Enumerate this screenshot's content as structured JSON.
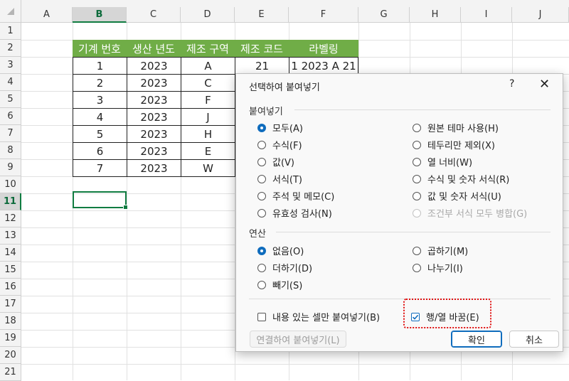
{
  "columns": [
    "A",
    "B",
    "C",
    "D",
    "E",
    "F",
    "G",
    "H",
    "I",
    "J"
  ],
  "rows": [
    "1",
    "2",
    "3",
    "4",
    "5",
    "6",
    "7",
    "8",
    "9",
    "10",
    "11",
    "12",
    "13",
    "14",
    "15",
    "16",
    "17",
    "18",
    "19",
    "20",
    "21"
  ],
  "table": {
    "headers": [
      "기계 번호",
      "생산 년도",
      "제조 구역",
      "제조 코드",
      "라벨링"
    ],
    "rows": [
      [
        "1",
        "2023",
        "A",
        "21",
        "1 2023 A 21"
      ],
      [
        "2",
        "2023",
        "C",
        "",
        ""
      ],
      [
        "3",
        "2023",
        "F",
        "",
        ""
      ],
      [
        "4",
        "2023",
        "J",
        "",
        ""
      ],
      [
        "5",
        "2023",
        "H",
        "",
        ""
      ],
      [
        "6",
        "2023",
        "E",
        "",
        ""
      ],
      [
        "7",
        "2023",
        "W",
        "",
        ""
      ]
    ]
  },
  "dialog": {
    "title": "선택하여 붙여넣기",
    "help": "?",
    "close": "✕",
    "paste_section": "붙여넣기",
    "paste_left": [
      "모두(A)",
      "수식(F)",
      "값(V)",
      "서식(T)",
      "주석 및 메모(C)",
      "유효성 검사(N)"
    ],
    "paste_right": [
      "원본 테마 사용(H)",
      "테두리만 제외(X)",
      "열 너비(W)",
      "수식 및 숫자 서식(R)",
      "값 및 숫자 서식(U)",
      "조건부 서식 모두 병합(G)"
    ],
    "op_section": "연산",
    "op_left": [
      "없음(O)",
      "더하기(D)",
      "빼기(S)"
    ],
    "op_right": [
      "곱하기(M)",
      "나누기(I)"
    ],
    "skip_blanks": "내용 있는 셀만 붙여넣기(B)",
    "transpose": "행/열 바꿈(E)",
    "paste_link": "연결하여 붙여넣기(L)",
    "ok": "확인",
    "cancel": "취소"
  },
  "colors": {
    "header_green": "#70ad47",
    "accent_blue": "#0f6cbd",
    "highlight_red": "#e01010",
    "excel_green": "#107c41"
  }
}
